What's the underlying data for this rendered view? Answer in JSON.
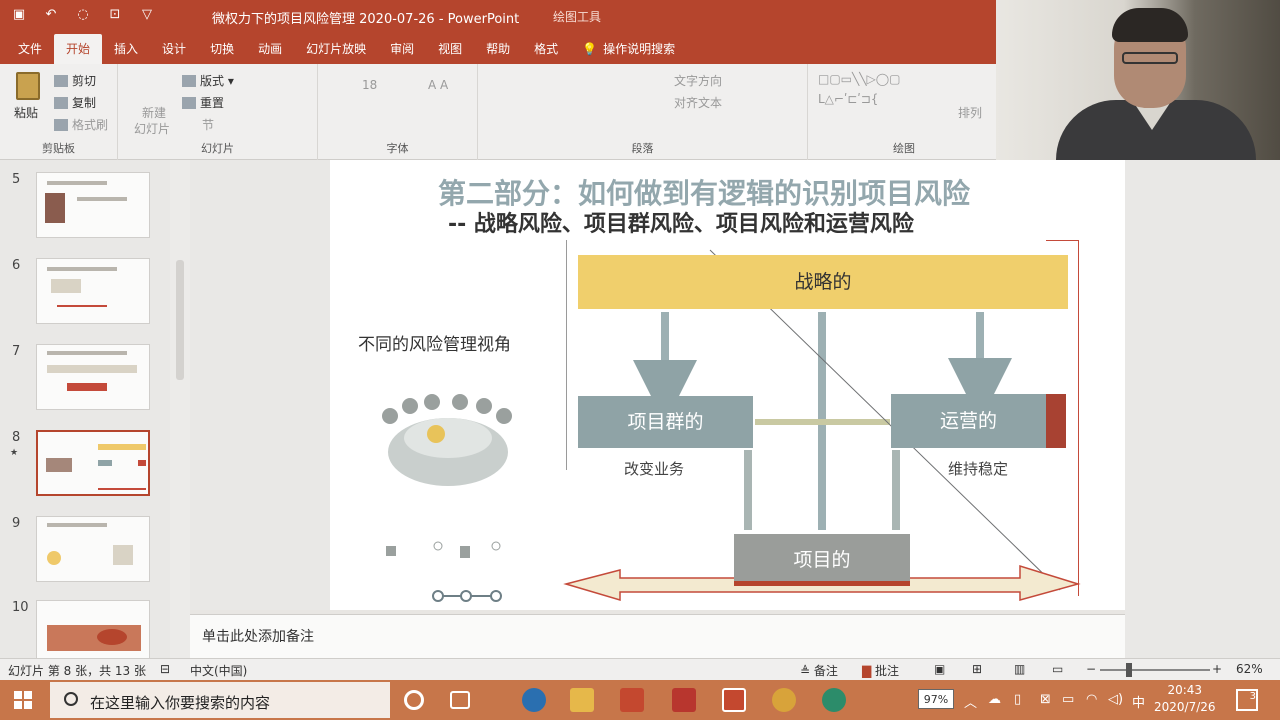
{
  "window": {
    "title": "微权力下的项目风险管理 2020-07-26  -  PowerPoint",
    "context_tab": "绘图工具"
  },
  "ribbon_tabs": [
    "文件",
    "开始",
    "插入",
    "设计",
    "切换",
    "动画",
    "幻灯片放映",
    "审阅",
    "视图",
    "帮助",
    "格式",
    "操作说明搜索"
  ],
  "ribbon": {
    "paste": "粘贴",
    "cut": "剪切",
    "copy": "复制",
    "format_painter": "格式刷",
    "clipboard_group": "剪贴板",
    "new_slide": "新建",
    "new_slide_sub": "幻灯片",
    "layout": "版式",
    "reset": "重置",
    "section": "节",
    "slides_group": "幻灯片",
    "font_size": "18",
    "font_group": "字体",
    "paragraph_group": "段落",
    "text_direction": "文字方向",
    "align_text": "对齐文本",
    "drawing_group": "绘图",
    "arrange": "排列"
  },
  "slides_panel": {
    "numbers": [
      "5",
      "6",
      "7",
      "8",
      "9",
      "10"
    ],
    "selected": "8",
    "star": "★"
  },
  "slide": {
    "title": "第二部分：如何做到有逻辑的识别项目风险",
    "subtitle": "-- 战略风险、项目群风险、项目风险和运营风险",
    "risk_view": "不同的风险管理视角",
    "strategic": "战略的",
    "program": "项目群的",
    "operations": "运营的",
    "project": "项目的",
    "change_business": "改变业务",
    "keep_stable": "维持稳定"
  },
  "notes": {
    "placeholder": "单击此处添加备注"
  },
  "status": {
    "slide_info": "幻灯片 第 8 张，共 13 张",
    "language": "中文(中国)",
    "notes": "备注",
    "comments": "批注",
    "zoom": "62%"
  },
  "taskbar": {
    "search_placeholder": "在这里输入你要搜索的内容",
    "battery": "97%",
    "ime": "中",
    "time": "20:43",
    "date": "2020/7/26",
    "notifications": "3"
  },
  "colors": {
    "accent": "#b5452d",
    "strategic_fill": "#f0cf6c",
    "teal_gray": "#8fa3a6",
    "red_accent": "#a84232",
    "taskbar": "#c7764a"
  }
}
